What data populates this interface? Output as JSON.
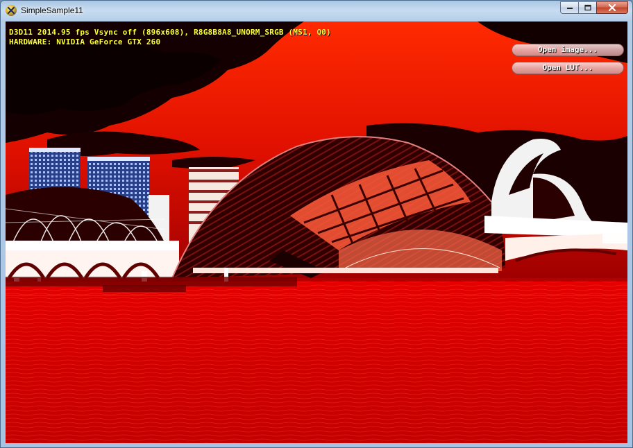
{
  "window": {
    "title": "SimpleSample11"
  },
  "hud": {
    "stats_line": "D3D11 2014.95 fps Vsync off (896x608), R8G8B8A8_UNORM_SRGB (MS1, Q0)",
    "hardware_line": "HARDWARE: NVIDIA GeForce GTX 260",
    "text_color": "#ffff33"
  },
  "buttons": {
    "open_image": "Open image...",
    "open_lut": "Open LUT..."
  },
  "icons": {
    "app": "directx-app-icon",
    "minimize": "minimize-icon",
    "maximize": "maximize-icon",
    "close": "close-icon"
  },
  "colors": {
    "scene_red": "#d40000",
    "sky_dark": "#140000",
    "water_red": "#cc0000"
  }
}
